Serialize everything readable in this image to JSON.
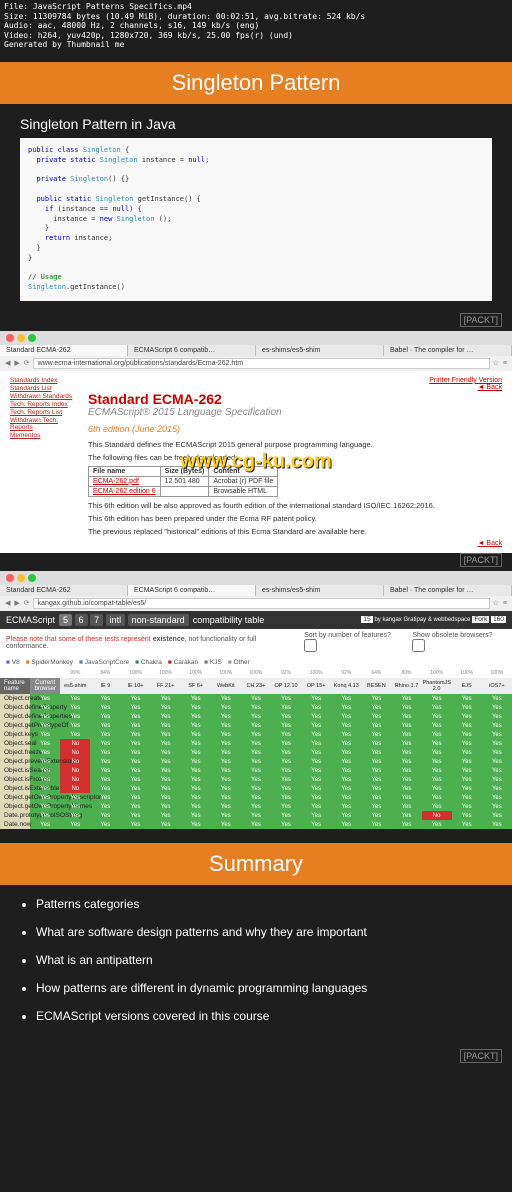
{
  "meta": {
    "file": "File: JavaScript Patterns Specifics.mp4",
    "size": "Size: 11309784 bytes (10.49 MiB), duration: 00:02:51, avg.bitrate: 524 kb/s",
    "audio": "Audio: aac, 48000 Hz, 2 channels, s16, 149 kb/s (eng)",
    "video": "Video: h264, yuv420p, 1280x720, 369 kb/s, 25.00 fps(r) (und)",
    "gen": "Generated by Thumbnail me"
  },
  "slide1": {
    "title": "Singleton Pattern",
    "subtitle": "Singleton Pattern in Java"
  },
  "packt": "[PACKT]",
  "browser1": {
    "tabs": [
      "Standard ECMA-262",
      "ECMAScript 6 compatib…",
      "es-shims/es5-shim",
      "Babel · The compiler for …"
    ],
    "url": "www.ecma-international.org/publications/standards/Ecma-262.htm",
    "sidenav": [
      "Standards Index",
      "Standards List",
      "Withdrawn Standards",
      "Tech. Reports Index",
      "Tech. Reports List",
      "Withdrawn Tech. Reports",
      "Mementos"
    ],
    "pf": "Printer Friendly Version",
    "back": "◄ Back",
    "h1": "Standard ECMA-262",
    "h2": "ECMAScript® 2015 Language Specification",
    "h3": "6th edition (June 2015)",
    "p1": "This Standard defines the ECMAScript 2015 general purpose programming language.",
    "p2": "The following files can be freely downloaded:",
    "thead": [
      "File name",
      "Size (Bytes)",
      "Content"
    ],
    "trows": [
      [
        "ECMA-262.pdf",
        "12 501 480",
        "Acrobat (r) PDF file"
      ],
      [
        "ECMA-262 edition 6",
        "",
        "Browsable HTML"
      ]
    ],
    "p3": "This 6th edition will be also approved as fourth edition of the international standard ISO/IEC 16262:2016.",
    "p4": "This 6th edition has been prepared under the Ecma RF patent policy.",
    "p5pre": "The previous replaced \"historical\" editions of this Ecma Standard are available ",
    "p5link": "here"
  },
  "watermark": "www.cg-ku.com",
  "browser2": {
    "tabs": [
      "Standard ECMA-262",
      "ECMAScript 6 compatib…",
      "es-shims/es5-shim",
      "Babel · The compiler for …"
    ],
    "url": "kangax.github.io/compat-table/es5/",
    "headTitle": "ECMAScript",
    "headTabs": [
      "5",
      "6",
      "7",
      "intl",
      "non-standard"
    ],
    "headRight": "compatibility table",
    "by": "by kangax  Gratipay  & webbedspace",
    "fork_n": "15",
    "fork_l": "Fork",
    "park_n": "160",
    "note1": "Please note that some of these tests represent ",
    "note2": "existence",
    "note3": ", not functionality or full conformance.",
    "sort": "Sort by number of features?",
    "obsolete": "Show obsolete browsers?",
    "legend": [
      "V8",
      "SpiderMonkey",
      "JavaScriptCore",
      "Chakra",
      "Carakan",
      "KJS",
      "Other"
    ],
    "colHead": "Feature name",
    "colCur": "Current browser",
    "browsers": [
      "es5-shim",
      "IE 9",
      "IE 10+",
      "FF 21+",
      "SF 6+",
      "WebKit",
      "CH 23+",
      "OP 12.10",
      "OP 15+",
      "Konq 4.13",
      "BESEN",
      "Rhino 1.7",
      "PhantomJS 2.0",
      "EJS",
      "iOS7+"
    ],
    "pcts": [
      "99%",
      "84%",
      "100%",
      "100%",
      "100%",
      "100%",
      "100%",
      "92%",
      "100%",
      "92%",
      "64%",
      "80%",
      "100%",
      "100%",
      "100%"
    ],
    "features": [
      {
        "n": "Object.create",
        "c": [
          "Yes",
          "Yes",
          "Yes",
          "Yes",
          "Yes",
          "Yes",
          "Yes",
          "Yes",
          "Yes",
          "Yes",
          "Yes",
          "Yes",
          "Yes",
          "Yes",
          "Yes",
          "Yes"
        ]
      },
      {
        "n": "Object.defineProperty",
        "c": [
          "Yes",
          "Yes",
          "Yes",
          "Yes",
          "Yes",
          "Yes",
          "Yes",
          "Yes",
          "Yes",
          "Yes",
          "Yes",
          "Yes",
          "Yes",
          "Yes",
          "Yes",
          "Yes"
        ]
      },
      {
        "n": "Object.defineProperties",
        "c": [
          "Yes",
          "Yes",
          "Yes",
          "Yes",
          "Yes",
          "Yes",
          "Yes",
          "Yes",
          "Yes",
          "Yes",
          "Yes",
          "Yes",
          "Yes",
          "Yes",
          "Yes",
          "Yes"
        ]
      },
      {
        "n": "Object.getPrototypeOf",
        "c": [
          "Yes",
          "Yes",
          "Yes",
          "Yes",
          "Yes",
          "Yes",
          "Yes",
          "Yes",
          "Yes",
          "Yes",
          "Yes",
          "Yes",
          "Yes",
          "Yes",
          "Yes",
          "Yes"
        ]
      },
      {
        "n": "Object.keys",
        "c": [
          "Yes",
          "Yes",
          "Yes",
          "Yes",
          "Yes",
          "Yes",
          "Yes",
          "Yes",
          "Yes",
          "Yes",
          "Yes",
          "Yes",
          "Yes",
          "Yes",
          "Yes",
          "Yes"
        ]
      },
      {
        "n": "Object.seal",
        "c": [
          "Yes",
          "No",
          "Yes",
          "Yes",
          "Yes",
          "Yes",
          "Yes",
          "Yes",
          "Yes",
          "Yes",
          "Yes",
          "Yes",
          "Yes",
          "Yes",
          "Yes",
          "Yes"
        ]
      },
      {
        "n": "Object.freeze",
        "c": [
          "Yes",
          "No",
          "Yes",
          "Yes",
          "Yes",
          "Yes",
          "Yes",
          "Yes",
          "Yes",
          "Yes",
          "Yes",
          "Yes",
          "Yes",
          "Yes",
          "Yes",
          "Yes"
        ]
      },
      {
        "n": "Object.preventExtensions",
        "c": [
          "Yes",
          "No",
          "Yes",
          "Yes",
          "Yes",
          "Yes",
          "Yes",
          "Yes",
          "Yes",
          "Yes",
          "Yes",
          "Yes",
          "Yes",
          "Yes",
          "Yes",
          "Yes"
        ]
      },
      {
        "n": "Object.isSealed",
        "c": [
          "Yes",
          "No",
          "Yes",
          "Yes",
          "Yes",
          "Yes",
          "Yes",
          "Yes",
          "Yes",
          "Yes",
          "Yes",
          "Yes",
          "Yes",
          "Yes",
          "Yes",
          "Yes"
        ]
      },
      {
        "n": "Object.isFrozen",
        "c": [
          "Yes",
          "No",
          "Yes",
          "Yes",
          "Yes",
          "Yes",
          "Yes",
          "Yes",
          "Yes",
          "Yes",
          "Yes",
          "Yes",
          "Yes",
          "Yes",
          "Yes",
          "Yes"
        ]
      },
      {
        "n": "Object.isExtensible",
        "c": [
          "Yes",
          "No",
          "Yes",
          "Yes",
          "Yes",
          "Yes",
          "Yes",
          "Yes",
          "Yes",
          "Yes",
          "Yes",
          "Yes",
          "Yes",
          "Yes",
          "Yes",
          "Yes"
        ]
      },
      {
        "n": "Object.getOwnPropertyDescriptor",
        "c": [
          "Yes",
          "Yes",
          "Yes",
          "Yes",
          "Yes",
          "Yes",
          "Yes",
          "Yes",
          "Yes",
          "Yes",
          "Yes",
          "Yes",
          "Yes",
          "Yes",
          "Yes",
          "Yes"
        ]
      },
      {
        "n": "Object.getOwnPropertyNames",
        "c": [
          "Yes",
          "Yes",
          "Yes",
          "Yes",
          "Yes",
          "Yes",
          "Yes",
          "Yes",
          "Yes",
          "Yes",
          "Yes",
          "Yes",
          "Yes",
          "Yes",
          "Yes",
          "Yes"
        ]
      },
      {
        "n": "Date.prototype.toISOString",
        "c": [
          "Yes",
          "Yes",
          "Yes",
          "Yes",
          "Yes",
          "Yes",
          "Yes",
          "Yes",
          "Yes",
          "Yes",
          "Yes",
          "Yes",
          "Yes",
          "No",
          "Yes",
          "Yes"
        ]
      },
      {
        "n": "Date.now",
        "c": [
          "Yes",
          "Yes",
          "Yes",
          "Yes",
          "Yes",
          "Yes",
          "Yes",
          "Yes",
          "Yes",
          "Yes",
          "Yes",
          "Yes",
          "Yes",
          "Yes",
          "Yes",
          "Yes"
        ]
      }
    ]
  },
  "summary": {
    "title": "Summary",
    "items": [
      "Patterns categories",
      "What are software design patterns and why they are important",
      "What is an antipattern",
      "How patterns are different in dynamic programming languages",
      "ECMAScript versions covered in this course"
    ]
  }
}
